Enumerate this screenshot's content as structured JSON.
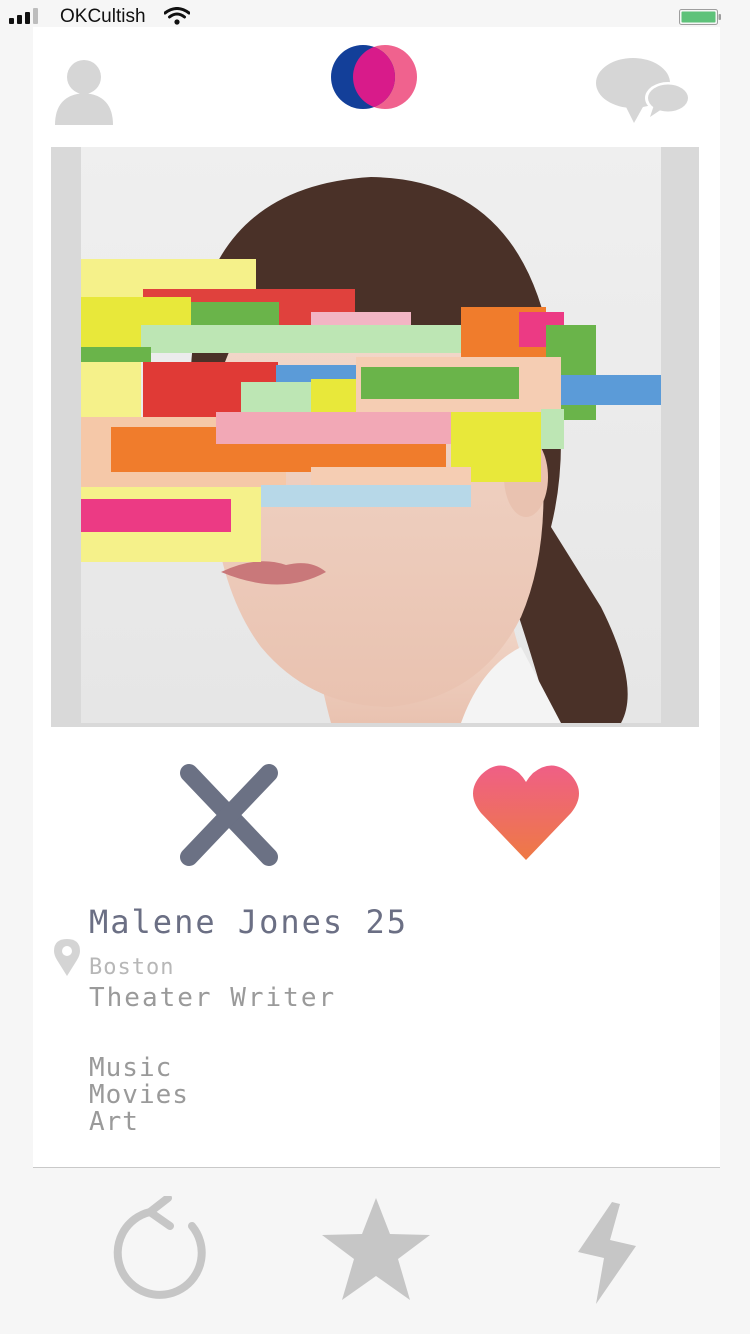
{
  "status_bar": {
    "carrier": "OKCultish"
  },
  "header": {
    "left_icon": "profile-icon",
    "center_icon": "app-logo",
    "right_icon": "messages-icon"
  },
  "profile": {
    "name_age": "Malene Jones 25",
    "city": "Boston",
    "occupation": "Theater Writer",
    "interests": [
      "Music",
      "Movies",
      "Art"
    ]
  },
  "actions": {
    "dislike_icon": "close-icon",
    "like_icon": "heart-icon"
  },
  "bottom_bar": {
    "icons": [
      "rewind-icon",
      "star-icon",
      "lightning-icon"
    ]
  },
  "colors": {
    "dislike": "#6b7184",
    "like_top": "#ef5f86",
    "like_bottom": "#ee7a44",
    "logo_blue": "#133f99",
    "logo_magenta": "#d81b8a",
    "logo_pink": "#f0628e",
    "battery": "#5ec27a",
    "inactive_icon": "#c6c6c6"
  }
}
